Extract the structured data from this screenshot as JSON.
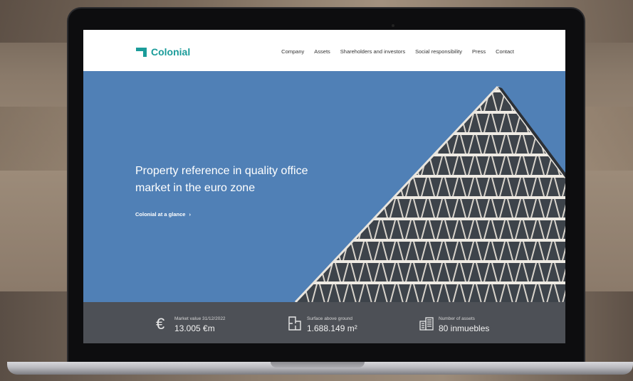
{
  "brand": {
    "name": "Colonial",
    "color": "#1b9c9a"
  },
  "nav": {
    "items": [
      "Company",
      "Assets",
      "Shareholders and investors",
      "Social responsibility",
      "Press",
      "Contact"
    ]
  },
  "hero": {
    "title": "Property reference in quality office market in the euro zone",
    "cta": "Colonial at a glance",
    "cta_icon": "chevron-right-icon",
    "background_color": "#5080b6"
  },
  "stats": [
    {
      "icon": "euro-icon",
      "label": "Market value 31/12/2022",
      "value": "13.005 €m"
    },
    {
      "icon": "floor-plan-icon",
      "label": "Surface above ground",
      "value": "1.688.149 m²"
    },
    {
      "icon": "buildings-icon",
      "label": "Number of assets",
      "value": "80 inmuebles"
    }
  ]
}
